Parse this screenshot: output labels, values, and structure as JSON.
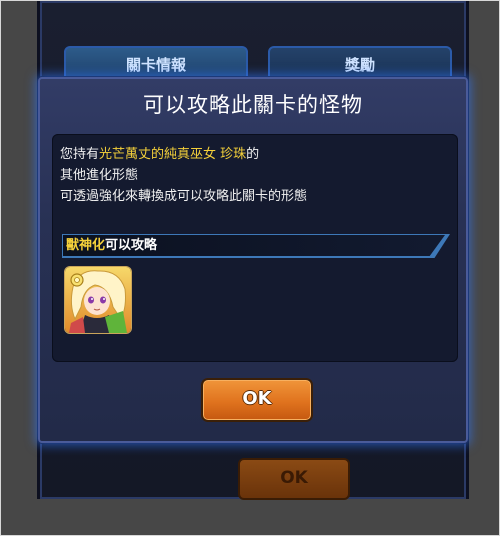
{
  "background": {
    "tabs": [
      {
        "label": "關卡情報"
      },
      {
        "label": "獎勵"
      }
    ],
    "ok_label": "OK"
  },
  "dialog": {
    "title": "可以攻略此關卡的怪物",
    "description": {
      "line1_prefix": "您持有",
      "monster_name": "光芒萬丈的純真巫女 珍珠",
      "line1_suffix": "的",
      "line2": "其他進化形態",
      "line3": "可透過強化來轉換成可以攻略此關卡的形態"
    },
    "form": {
      "name": "獸神化",
      "suffix": "可以攻略"
    },
    "ok_label": "OK"
  },
  "colors": {
    "highlight": "#f5d13a",
    "ok_button": "#e0731e",
    "dialog_border": "#4a5b9a"
  }
}
